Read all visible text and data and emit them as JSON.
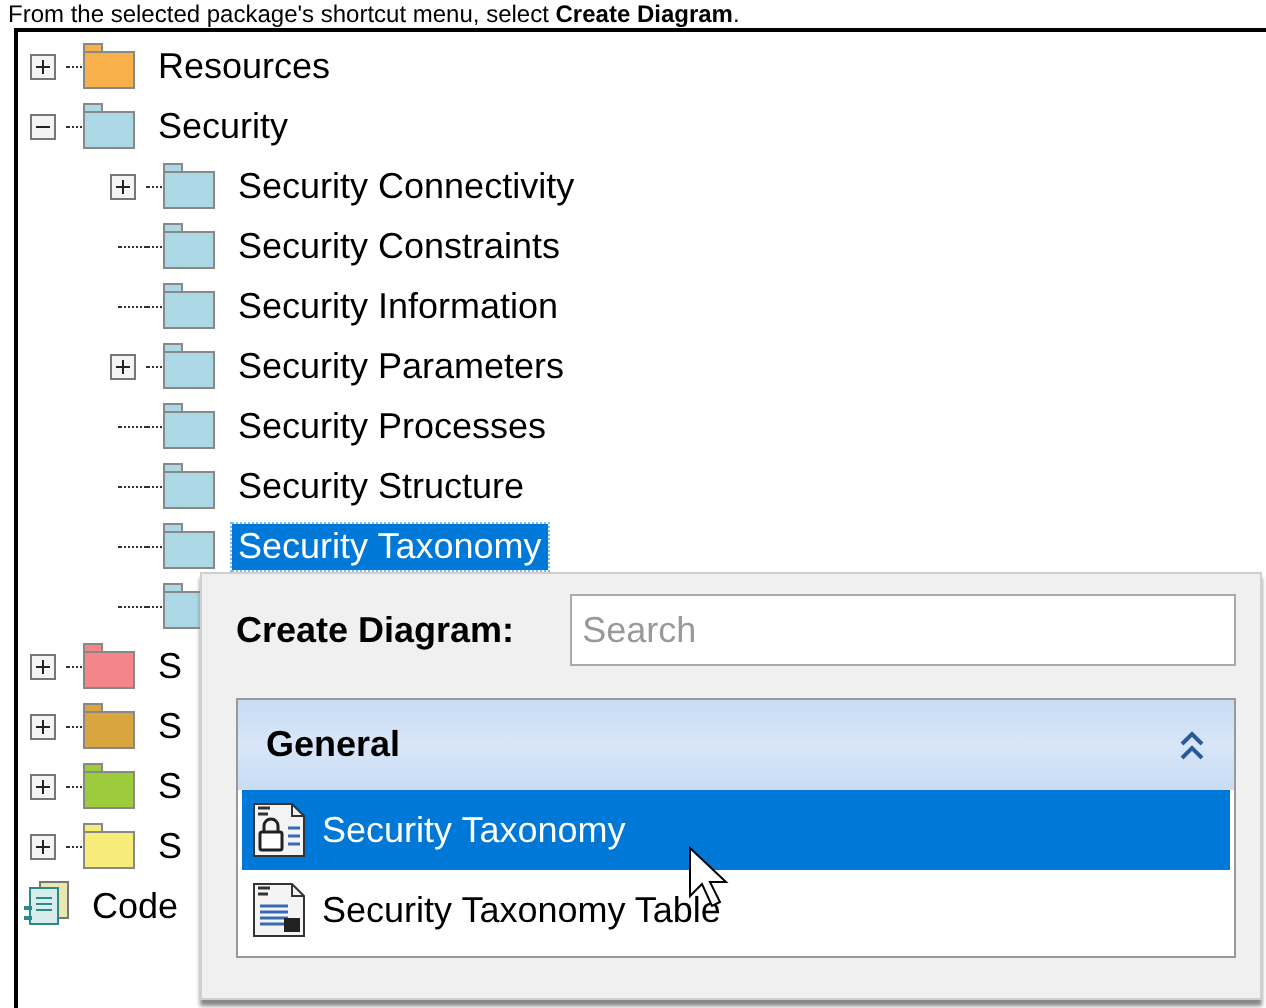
{
  "caption": "From the selected package's shortcut menu, select **Create Diagram**.",
  "tree": [
    {
      "kind": "folder",
      "label": "Resources",
      "color": "#f8b04a",
      "expanded": false,
      "selected": false
    },
    {
      "kind": "folder",
      "label": "Security",
      "color": "#add8e6",
      "expanded": true,
      "selected": false,
      "children": [
        {
          "kind": "folder",
          "label": "Security Connectivity",
          "color": "#add8e6",
          "expanded": false,
          "selected": false
        },
        {
          "kind": "folder",
          "label": "Security Constraints",
          "color": "#add8e6",
          "selected": false
        },
        {
          "kind": "folder",
          "label": "Security Information",
          "color": "#add8e6",
          "selected": false
        },
        {
          "kind": "folder",
          "label": "Security Parameters",
          "color": "#add8e6",
          "expanded": false,
          "selected": false
        },
        {
          "kind": "folder",
          "label": "Security Processes",
          "color": "#add8e6",
          "selected": false
        },
        {
          "kind": "folder",
          "label": "Security Structure",
          "color": "#add8e6",
          "selected": false
        },
        {
          "kind": "folder",
          "label": "Security Taxonomy",
          "color": "#add8e6",
          "selected": true
        },
        {
          "kind": "folder",
          "color": "#add8e6"
        }
      ]
    },
    {
      "kind": "folder",
      "label": "S",
      "color": "#f4868a",
      "expanded": false,
      "selected": false
    },
    {
      "kind": "folder",
      "label": "S",
      "color": "#d9a53e",
      "expanded": false,
      "selected": false
    },
    {
      "kind": "folder",
      "label": "S",
      "color": "#9ccc3c",
      "expanded": false,
      "selected": false
    },
    {
      "kind": "folder",
      "label": "S",
      "color": "#f7ec7a",
      "expanded": false,
      "selected": false
    },
    {
      "kind": "code",
      "label": "Code",
      "selected": false
    }
  ],
  "popup": {
    "title": "Create Diagram:",
    "search": {
      "placeholder": "Search"
    },
    "group": {
      "label": "General",
      "expanded": true,
      "items": [
        {
          "label": "Security Taxonomy",
          "kind": "diagram",
          "selected": true
        },
        {
          "label": "Security Taxonomy Table",
          "kind": "table",
          "selected": false
        }
      ]
    }
  }
}
